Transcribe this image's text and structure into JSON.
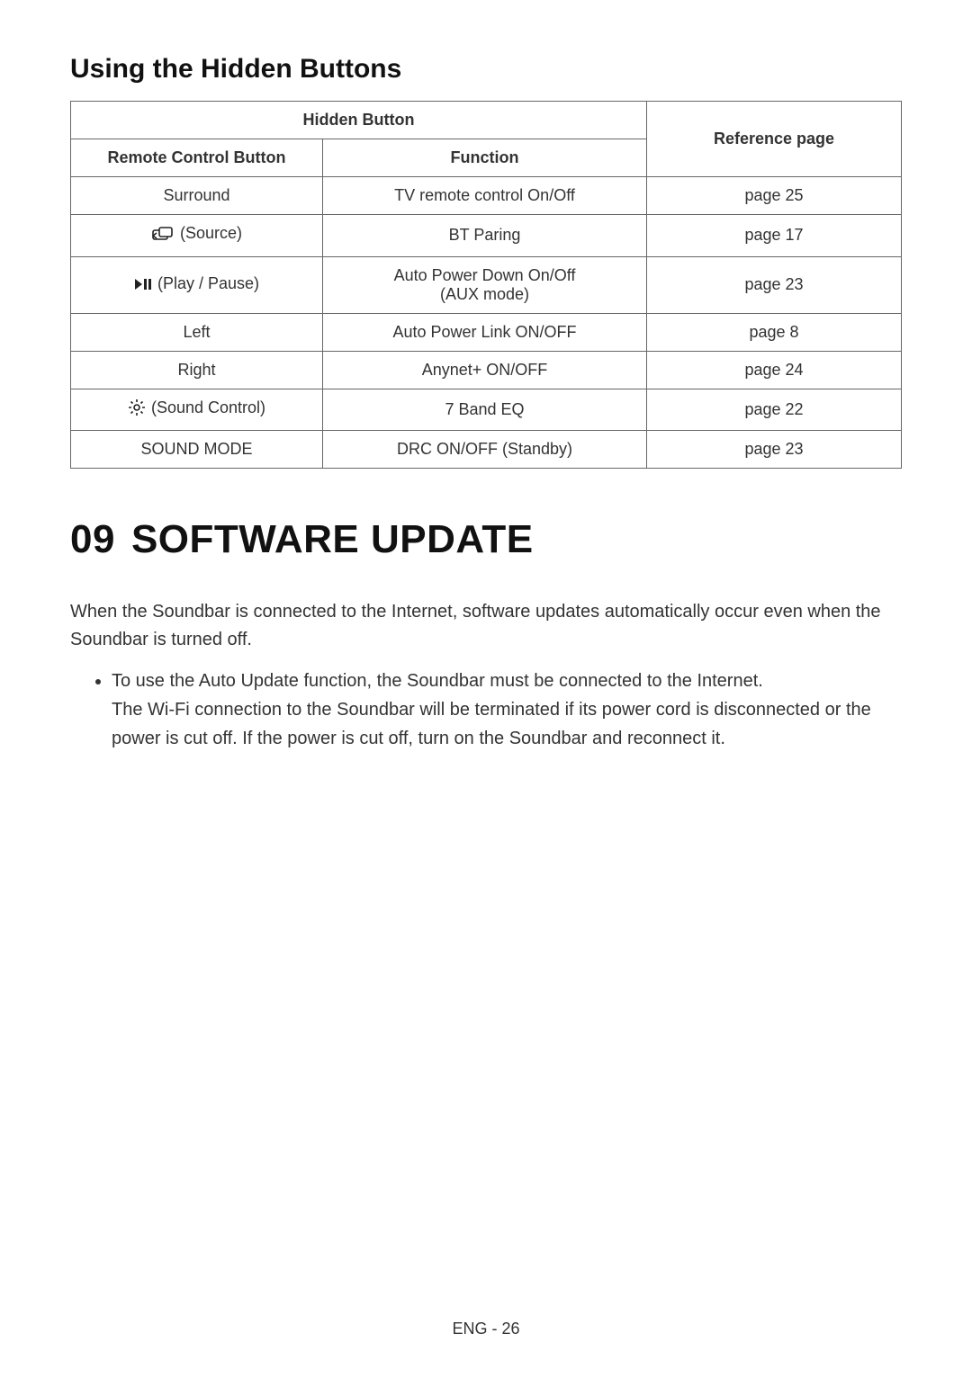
{
  "section_title": "Using the Hidden Buttons",
  "table": {
    "header": {
      "hidden_button": "Hidden Button",
      "remote": "Remote Control Button",
      "function": "Function",
      "reference": "Reference page"
    },
    "rows": [
      {
        "remote_icon": null,
        "remote_label": "Surround",
        "function": "TV remote control On/Off",
        "ref": "page 25"
      },
      {
        "remote_icon": "source-icon",
        "remote_label": "(Source)",
        "function": "BT Paring",
        "ref": "page 17"
      },
      {
        "remote_icon": "playpause-icon",
        "remote_label": "(Play / Pause)",
        "function": "Auto Power Down On/Off\n(AUX mode)",
        "ref": "page 23"
      },
      {
        "remote_icon": null,
        "remote_label": "Left",
        "function": "Auto Power Link ON/OFF",
        "ref": "page 8"
      },
      {
        "remote_icon": null,
        "remote_label": "Right",
        "function": "Anynet+ ON/OFF",
        "ref": "page 24"
      },
      {
        "remote_icon": "gear-icon",
        "remote_label": "(Sound Control)",
        "function": "7 Band EQ",
        "ref": "page 22"
      },
      {
        "remote_icon": null,
        "remote_label": "SOUND MODE",
        "function": "DRC ON/OFF (Standby)",
        "ref": "page 23"
      }
    ]
  },
  "chapter": {
    "number": "09",
    "title": "SOFTWARE UPDATE"
  },
  "paragraph": "When the Soundbar is connected to the Internet, software updates automatically occur even when the Soundbar is turned off.",
  "bullets": [
    {
      "line1": "To use the Auto Update function, the Soundbar must be connected to the Internet.",
      "line2": "The Wi-Fi connection to the Soundbar will be terminated if its power cord is disconnected or the power is cut off. If the power is cut off, turn on the Soundbar and reconnect it."
    }
  ],
  "footer": "ENG - 26"
}
